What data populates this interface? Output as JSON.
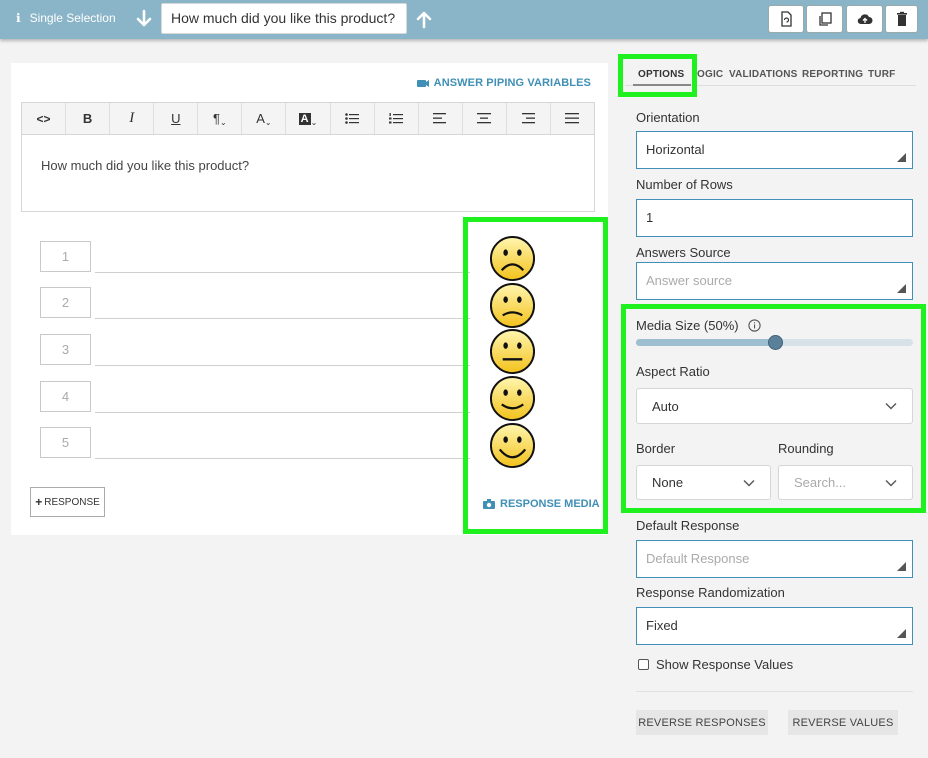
{
  "header": {
    "question_type": "Single Selection",
    "question_text": "How much did you like this product?"
  },
  "editor": {
    "piping_label": "ANSWER PIPING VARIABLES",
    "toolbar_glyphs": {
      "code": "<>",
      "bold": "B",
      "italic": "I",
      "underline": "U",
      "paragraph": "¶",
      "font_color": "A",
      "highlight": "A"
    },
    "body_text": "How much did you like this product?",
    "responses": [
      "1",
      "2",
      "3",
      "4",
      "5"
    ],
    "add_response_label": "RESPONSE",
    "response_media_label": "RESPONSE MEDIA"
  },
  "tabs": {
    "options": "OPTIONS",
    "logic": "OGIC",
    "validations": "VALIDATIONS",
    "reporting": "REPORTING",
    "turf": "TURF"
  },
  "panel": {
    "orientation_label": "Orientation",
    "orientation_value": "Horizontal",
    "rows_label": "Number of Rows",
    "rows_value": "1",
    "answers_source_label": "Answers Source",
    "answers_source_placeholder": "Answer source",
    "media_size_label": "Media Size (50%)",
    "media_size_value": 0.5,
    "aspect_ratio_label": "Aspect Ratio",
    "aspect_ratio_value": "Auto",
    "border_label": "Border",
    "border_value": "None",
    "rounding_label": "Rounding",
    "rounding_placeholder": "Search...",
    "default_response_label": "Default Response",
    "default_response_placeholder": "Default Response",
    "randomization_label": "Response Randomization",
    "randomization_value": "Fixed",
    "show_values_label": "Show Response Values",
    "show_values_checked": false,
    "reverse_responses_label": "REVERSE RESPONSES",
    "reverse_values_label": "REVERSE VALUES"
  },
  "colors": {
    "topbar": "#8ab4c8",
    "accent": "#3f8fb6",
    "highlight": "#1ef11e"
  }
}
